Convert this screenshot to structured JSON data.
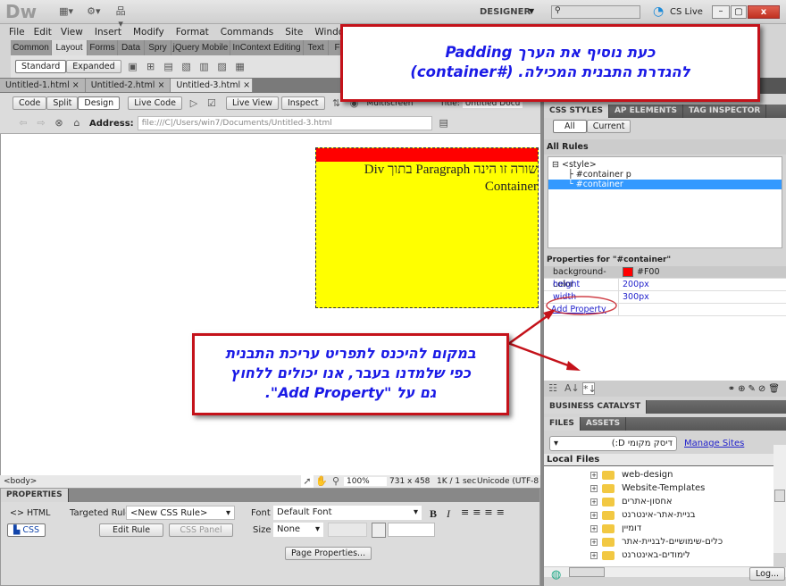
{
  "app": {
    "logo": "Dw",
    "workspace": "DESIGNER",
    "cslive": "CS Live"
  },
  "menu": [
    "File",
    "Edit",
    "View",
    "Insert",
    "Modify",
    "Format",
    "Commands",
    "Site",
    "Window"
  ],
  "insert_tabs": [
    "Common",
    "Layout",
    "Forms",
    "Data",
    "Spry",
    "jQuery Mobile",
    "InContext Editing",
    "Text",
    "F"
  ],
  "insert_modes": [
    "Standard",
    "Expanded"
  ],
  "doc_tabs": [
    "Untitled-1.html",
    "Untitled-2.html",
    "Untitled-3.html"
  ],
  "doc_toolbar": {
    "views": [
      "Code",
      "Split",
      "Design"
    ],
    "live_code": "Live Code",
    "live_view": "Live View",
    "inspect": "Inspect",
    "multiscreen": "Multiscreen",
    "title_label": "Title:",
    "title_value": "Untitled Docu"
  },
  "address": {
    "label": "Address:",
    "value": "file:///C|/Users/win7/Documents/Untitled-3.html"
  },
  "canvas": {
    "paragraph": "שורה זו הינה Paragraph בתוך Div Container",
    "bg": "#FFFF00",
    "top": "#FF0000"
  },
  "status": {
    "tag": "<body>",
    "zoom": "100%",
    "size": "731 x 458",
    "speed": "1K / 1 sec",
    "encoding": "Unicode (UTF-8"
  },
  "properties": {
    "title": "PROPERTIES",
    "html": "HTML",
    "css": "CSS",
    "targeted_rule_label": "Targeted Rule",
    "targeted_rule": "<New CSS Rule>",
    "edit_rule": "Edit Rule",
    "css_panel": "CSS Panel",
    "font_label": "Font",
    "font": "Default Font",
    "size_label": "Size",
    "size": "None",
    "page_properties": "Page Properties..."
  },
  "css_panel": {
    "tabs": [
      "CSS STYLES",
      "AP ELEMENTS",
      "TAG INSPECTOR"
    ],
    "modes": [
      "All",
      "Current"
    ],
    "all_rules": "All Rules",
    "tree": [
      "<style>",
      "#container p",
      "#container"
    ],
    "props_title": "Properties for \"#container\"",
    "props": [
      {
        "name": "background-color",
        "value": "#F00",
        "swatch": "#FF0000"
      },
      {
        "name": "height",
        "value": "200px"
      },
      {
        "name": "width",
        "value": "300px"
      }
    ],
    "add_property": "Add Property"
  },
  "bc": "BUSINESS CATALYST",
  "files": {
    "tabs": [
      "FILES",
      "ASSETS"
    ],
    "site": "דיסק מקומי D:)",
    "manage": "Manage Sites",
    "local": "Local Files",
    "items": [
      "web-design",
      "Website-Templates",
      "אחסון-אתרים",
      "בניית-אתר-אינטרנט",
      "דומיין",
      "כלים-שימושיים-לבניית-אתר",
      "לימודים-באינטרנט"
    ],
    "log": "Log..."
  },
  "callouts": {
    "top_line1": "כעת נוסיף את הערך Padding",
    "top_line2": "להגדרת התבנית המכילה.  (#container)",
    "mid_line1": "במקום להיכנס לתפריט עריכת התבנית",
    "mid_line2": "כפי שלמדנו בעבר, אנו יכולים ללחוץ",
    "mid_line3": "גם על \"Add Property\"."
  }
}
